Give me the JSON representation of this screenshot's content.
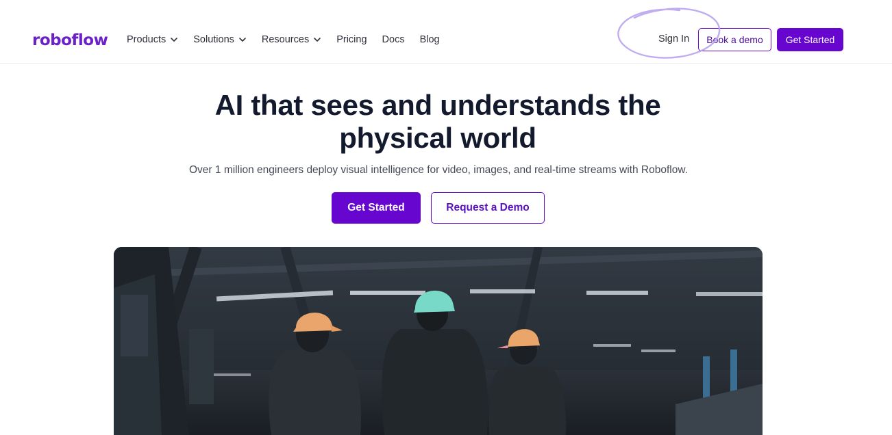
{
  "header": {
    "logo": "roboflow",
    "nav": [
      {
        "label": "Products",
        "has_dropdown": true,
        "icon": "chevron-down-icon"
      },
      {
        "label": "Solutions",
        "has_dropdown": true,
        "icon": "chevron-down-icon"
      },
      {
        "label": "Resources",
        "has_dropdown": true,
        "icon": "chevron-down-icon"
      },
      {
        "label": "Pricing",
        "has_dropdown": false
      },
      {
        "label": "Docs",
        "has_dropdown": false
      },
      {
        "label": "Blog",
        "has_dropdown": false
      }
    ],
    "sign_in": "Sign In",
    "book_demo": "Book a demo",
    "get_started": "Get Started"
  },
  "hero": {
    "title_line1": "AI that sees and understands the",
    "title_line2": "physical world",
    "subtitle": "Over 1 million engineers deploy visual intelligence for video, images, and real-time streams with Roboflow.",
    "primary_cta": "Get Started",
    "secondary_cta": "Request a Demo"
  },
  "media": {
    "type": "video",
    "scene": "industrial-warehouse-workers-hard-hats"
  },
  "colors": {
    "brand": "#6706ce",
    "logo": "#6b21c8",
    "heading": "#141a2e",
    "annotation_circle": "#b9a4ef"
  }
}
